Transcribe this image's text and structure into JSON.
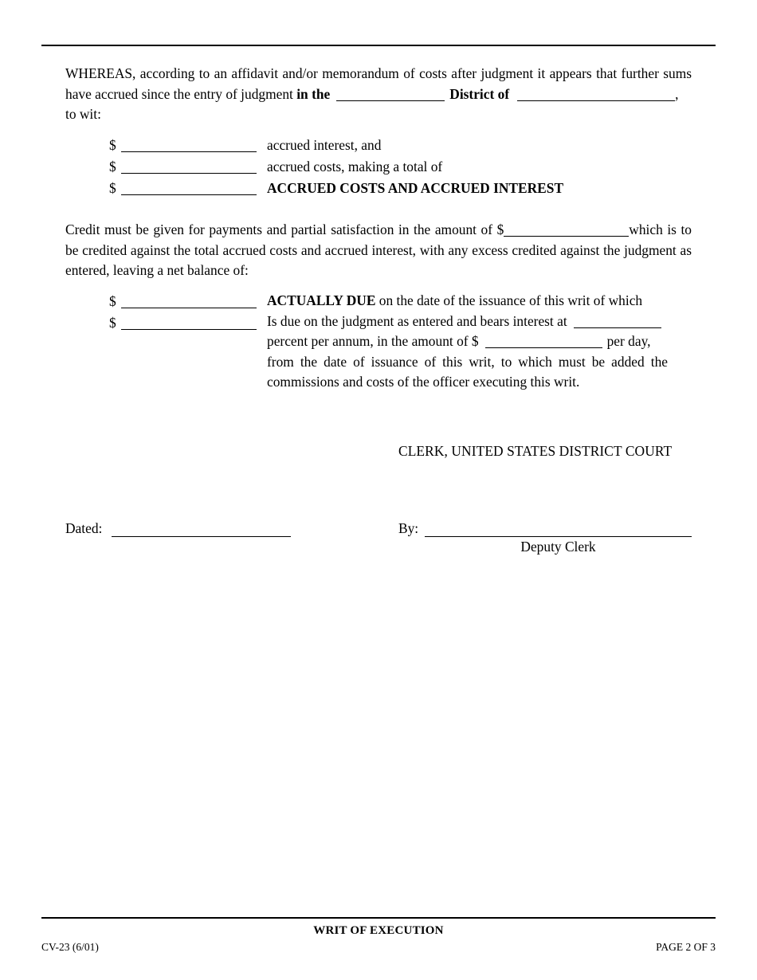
{
  "document": {
    "form_title": "WRIT OF EXECUTION",
    "form_number": "CV-23 (6/01)",
    "page_label": "PAGE 2 OF 3"
  },
  "whereas": {
    "part1": "WHEREAS, according to an affidavit and/or memorandum of costs after judgment it appears that further sums have accrued since the entry of judgment",
    "in_the": "in the",
    "district_of": "District of",
    "comma": ",",
    "to_wit": "to wit:"
  },
  "accrued_items": [
    {
      "currency": "$",
      "label": "accrued interest, and",
      "bold": false
    },
    {
      "currency": "$",
      "label": "accrued costs, making a total of",
      "bold": false
    },
    {
      "currency": "$",
      "label": "ACCRUED COSTS AND ACCRUED INTEREST",
      "bold": true
    }
  ],
  "credit": {
    "part1": "Credit must be given for payments and partial satisfaction in the amount of $",
    "part2": "which is to be credited against the total accrued costs and accrued interest, with any excess credited against the judgment as entered, leaving a net balance of:"
  },
  "due_items": [
    {
      "currency": "$"
    },
    {
      "currency": "$"
    }
  ],
  "due_text": {
    "actually_due": "ACTUALLY DUE",
    "line1_rest": "on the date of the issuance of this writ of which",
    "line2": "Is due on the judgment as entered and bears interest at",
    "line3a": "percent per annum, in the amount of $",
    "line3b": "per day,",
    "line4": "from the date of issuance of this writ, to which must be added the commissions and costs of the officer executing this writ."
  },
  "signature": {
    "clerk_title": "CLERK, UNITED STATES DISTRICT COURT",
    "dated_label": "Dated:",
    "by_label": "By:",
    "deputy_clerk": "Deputy Clerk"
  }
}
